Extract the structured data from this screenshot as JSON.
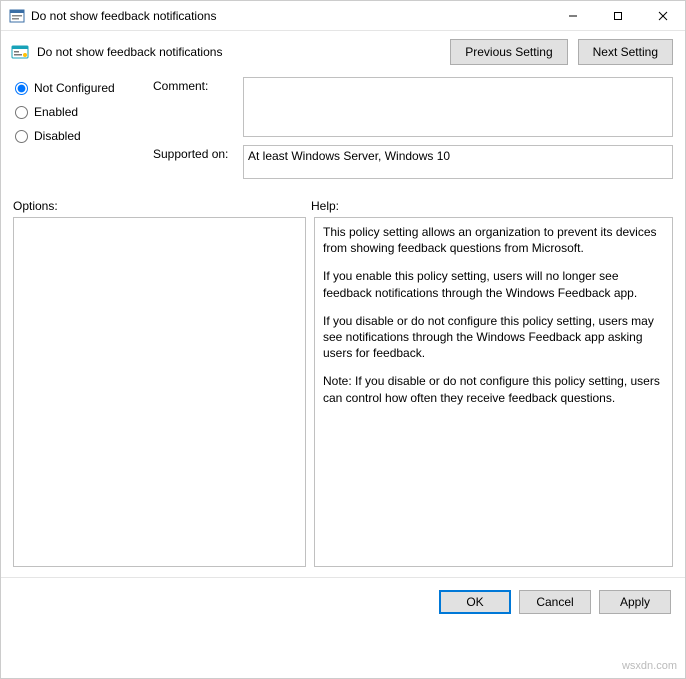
{
  "window": {
    "title": "Do not show feedback notifications"
  },
  "header": {
    "policy_title": "Do not show feedback notifications",
    "prev_label": "Previous Setting",
    "next_label": "Next Setting"
  },
  "radios": {
    "not_configured": "Not Configured",
    "enabled": "Enabled",
    "disabled": "Disabled",
    "selected": "not_configured"
  },
  "fields": {
    "comment_label": "Comment:",
    "comment_value": "",
    "supported_label": "Supported on:",
    "supported_value": "At least Windows Server, Windows 10"
  },
  "section_labels": {
    "options": "Options:",
    "help": "Help:"
  },
  "help_paragraphs": [
    "This policy setting allows an organization to prevent its devices from showing feedback questions from Microsoft.",
    "If you enable this policy setting, users will no longer see feedback notifications through the Windows Feedback app.",
    "If you disable or do not configure this policy setting, users may see notifications through the Windows Feedback app asking users for feedback.",
    "Note: If you disable or do not configure this policy setting, users can control how often they receive feedback questions."
  ],
  "buttons": {
    "ok": "OK",
    "cancel": "Cancel",
    "apply": "Apply"
  },
  "watermark": "wsxdn.com"
}
